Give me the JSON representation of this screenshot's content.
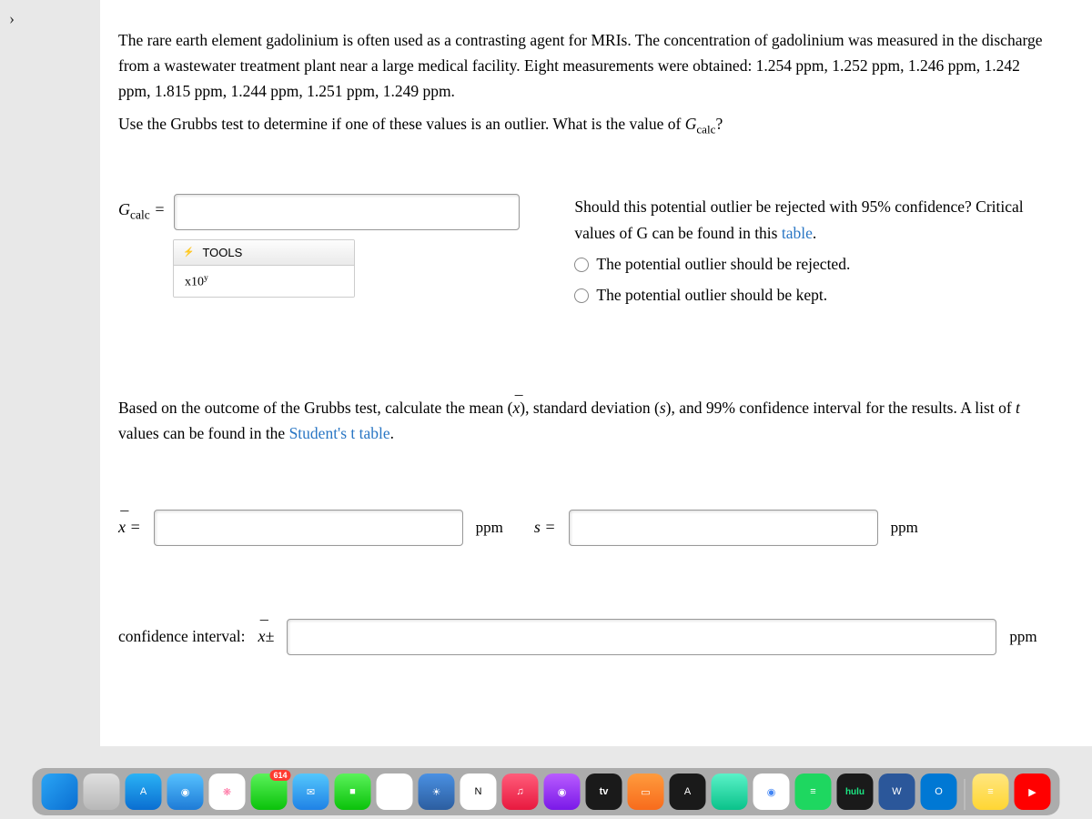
{
  "back_chevron": "›",
  "problem": {
    "p1_a": "The rare earth element gadolinium is often used as a contrasting agent for MRIs. The concentration of gadolinium was measured in the discharge from a wastewater treatment plant near a large medical facility. Eight measurements were obtained: 1.254 ppm, 1.252 ppm, 1.246 ppm, 1.242 ppm, 1.815 ppm, 1.244 ppm, 1.251 ppm, 1.249 ppm.",
    "p2_a": "Use the Grubbs test to determine if one of these values is an outlier. What is the value of ",
    "p2_b": "G",
    "p2_c": "calc",
    "p2_d": "?"
  },
  "gcalc": {
    "label_g": "G",
    "label_sub": "calc",
    "equals": " ="
  },
  "tools": {
    "header": "TOOLS",
    "item_x10": "x10",
    "item_x10_sup": "y"
  },
  "outlier": {
    "q1": "Should this potential outlier be rejected with 95% confidence? Critical values of ",
    "q1_g": "G",
    "q1_b": " can be found in this ",
    "q1_link": "table",
    "q1_end": ".",
    "opt1": "The potential outlier should be rejected.",
    "opt2": "The potential outlier should be kept."
  },
  "section2": {
    "p_a": "Based on the outcome of the Grubbs test, calculate the mean (",
    "p_b": "), standard deviation (",
    "p_s": "s",
    "p_c": "), and 99% confidence interval for the results. A list of ",
    "p_t": "t",
    "p_d": " values can be found in the ",
    "p_link": "Student's t table",
    "p_end": "."
  },
  "inputs": {
    "xbar_label": "x",
    "equals": " =",
    "ppm": "ppm",
    "s_label": "s",
    "ci_label": "confidence interval:",
    "ci_symbol": "x",
    "ci_pm": "±"
  },
  "dock": {
    "items": [
      {
        "name": "finder",
        "bg": "linear-gradient(135deg,#2aa5f5,#0a6ed1)",
        "text": ""
      },
      {
        "name": "launchpad",
        "bg": "linear-gradient(#e0e0e0,#b8b8b8)",
        "text": ""
      },
      {
        "name": "appstore",
        "bg": "linear-gradient(#2ab2f5,#0a6ed1)",
        "text": "A",
        "badge": ""
      },
      {
        "name": "safari",
        "bg": "linear-gradient(#56c1ff,#1e7bd6)",
        "text": "◉"
      },
      {
        "name": "photos",
        "bg": "#fff",
        "text": "❋"
      },
      {
        "name": "messages",
        "bg": "linear-gradient(#5af25a,#0ac20a)",
        "text": "",
        "badge": "614"
      },
      {
        "name": "mail",
        "bg": "linear-gradient(#54c7fc,#1f82e6)",
        "text": "✉"
      },
      {
        "name": "facetime",
        "bg": "linear-gradient(#5af25a,#0ac20a)",
        "text": "■"
      },
      {
        "name": "numbers",
        "bg": "#fff",
        "text": "▦"
      },
      {
        "name": "weather",
        "bg": "linear-gradient(#4a90e2,#2c5ea0)",
        "text": "☀"
      },
      {
        "name": "notion",
        "bg": "#fff",
        "text": "N"
      },
      {
        "name": "music",
        "bg": "linear-gradient(#ff5c7a,#e8193f)",
        "text": "♫"
      },
      {
        "name": "podcasts",
        "bg": "linear-gradient(#b95cff,#7a19e8)",
        "text": "◉"
      },
      {
        "name": "tv",
        "bg": "#1a1a1a",
        "text": "tv"
      },
      {
        "name": "books",
        "bg": "linear-gradient(#ff9b3d,#f76b1c)",
        "text": "▭"
      },
      {
        "name": "translate",
        "bg": "#1a1a1a",
        "text": "A"
      },
      {
        "name": "freeform",
        "bg": "linear-gradient(#5af2c8,#0ac28a)",
        "text": ""
      },
      {
        "name": "chrome",
        "bg": "#fff",
        "text": "◉"
      },
      {
        "name": "spotify",
        "bg": "#1ed760",
        "text": "≡"
      },
      {
        "name": "hulu",
        "bg": "#1a1a1a",
        "text": "hulu"
      },
      {
        "name": "word",
        "bg": "#2b579a",
        "text": "W"
      },
      {
        "name": "outlook",
        "bg": "#0078d4",
        "text": "O"
      },
      {
        "name": "notes",
        "bg": "linear-gradient(#ffe680,#ffd633)",
        "text": "≡"
      },
      {
        "name": "youtube",
        "bg": "#ff0000",
        "text": "▶"
      }
    ],
    "tv_label": "tv"
  }
}
